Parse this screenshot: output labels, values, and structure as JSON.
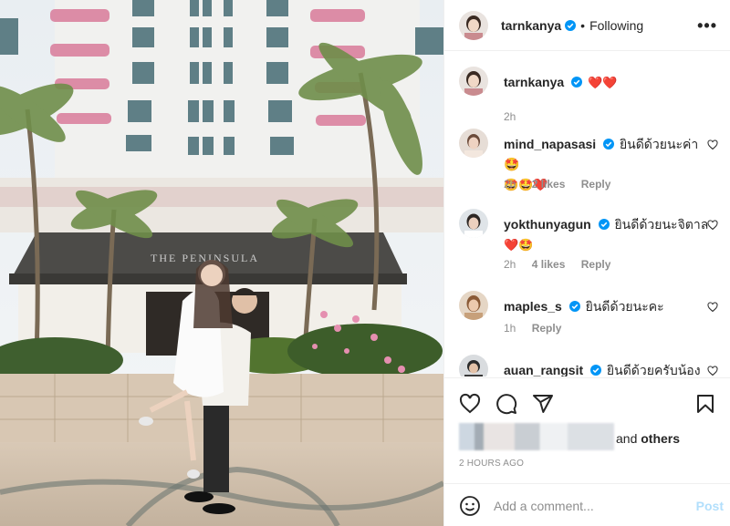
{
  "header": {
    "username": "tarnkanya",
    "separator": "•",
    "following_label": "Following",
    "more_label": "•••"
  },
  "caption": {
    "username": "tarnkanya",
    "text": "❤️❤️",
    "time": "2h"
  },
  "comments": [
    {
      "username": "mind_napasasi",
      "text": "ยินดีด้วยนะค่า🤩",
      "text2": "🤩🤩❤️",
      "time": "2h",
      "likes": "2 likes",
      "reply": "Reply"
    },
    {
      "username": "yokthunyagun",
      "text": "ยินดีด้วยนะจิตาล",
      "text2": "❤️🤩",
      "time": "2h",
      "likes": "4 likes",
      "reply": "Reply"
    },
    {
      "username": "maples_s",
      "text": "ยินดีด้วยนะคะ",
      "time": "1h",
      "reply": "Reply"
    },
    {
      "username": "auan_rangsit",
      "text": "ยินดีด้วยครับน้อง🎉",
      "time": ""
    }
  ],
  "likes": {
    "suffix": "and",
    "others": "others"
  },
  "timestamp": "2 HOURS AGO",
  "comment_box": {
    "placeholder": "Add a comment...",
    "post_label": "Post"
  },
  "photo": {
    "sign_text": "THE PENINSULA"
  },
  "colors": {
    "verified": "#0095f6",
    "heart": "#ed4956",
    "post_disabled": "#b2dffc"
  },
  "icons": [
    "heart-icon",
    "comment-icon",
    "share-icon",
    "bookmark-icon",
    "emoji-icon",
    "verified-icon"
  ]
}
